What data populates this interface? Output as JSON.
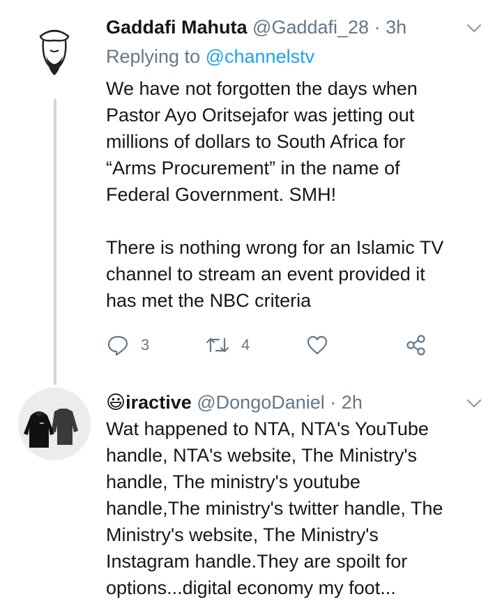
{
  "tweets": [
    {
      "display_name": "Gaddafi Mahuta",
      "handle": "@Gaddafi_28",
      "separator": "·",
      "time": "3h",
      "replying_to_prefix": "Replying to ",
      "replying_to_handle": "@channelstv",
      "body_lines": [
        "We have not forgotten the days when",
        "Pastor Ayo Oritsejafor was jetting out",
        "millions of dollars to South Africa for",
        "“Arms Procurement” in the name of",
        "Federal Government. SMH!",
        "",
        "There is nothing wrong for an Islamic TV",
        "channel to stream an event provided it",
        "has met the NBC criteria"
      ],
      "reply_count": "3",
      "retweet_count": "4",
      "like_count": "",
      "icons": [
        "reply-icon",
        "retweet-icon",
        "like-icon",
        "share-icon",
        "chevron-down-icon"
      ]
    },
    {
      "emoji": "😃",
      "display_name": "iractive",
      "handle": "@DongoDaniel",
      "separator": "·",
      "time": "2h",
      "body_lines": [
        "Wat happened to NTA, NTA's YouTube",
        "handle, NTA's website, The Ministry's",
        "handle, The ministry's youtube",
        "handle,The ministry's twitter handle, The",
        "Ministry's website, The Ministry's",
        "Instagram handle.They are spoilt for",
        "options...digital economy my foot..."
      ],
      "icons": [
        "chevron-down-icon"
      ]
    }
  ],
  "colors": {
    "text": "#14171a",
    "secondary": "#657786",
    "link": "#1da1f2",
    "thread_line": "#ccd6dd",
    "background": "#ffffff"
  }
}
